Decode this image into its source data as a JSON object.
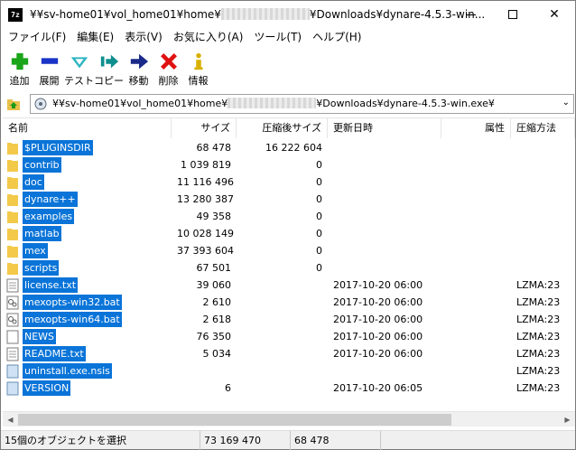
{
  "window": {
    "title_prefix": "¥¥sv-home01¥vol_home01¥home¥",
    "title_suffix": "¥Downloads¥dynare-4.5.3-win...",
    "app_icon_text": "7z"
  },
  "menu": [
    "ファイル(F)",
    "編集(E)",
    "表示(V)",
    "お気に入り(A)",
    "ツール(T)",
    "ヘルプ(H)"
  ],
  "toolbar": [
    {
      "label": "追加",
      "icon": "add-plus-icon",
      "color": "#1aa51a"
    },
    {
      "label": "展開",
      "icon": "extract-minus-icon",
      "color": "#1a34c8"
    },
    {
      "label": "テスト",
      "icon": "test-check-icon",
      "color": "#2bb3c0"
    },
    {
      "label": "コピー",
      "icon": "copy-arrow-icon",
      "color": "#0e8f8f"
    },
    {
      "label": "移動",
      "icon": "move-arrow-icon",
      "color": "#1a2a8a"
    },
    {
      "label": "削除",
      "icon": "delete-x-icon",
      "color": "#e01010"
    },
    {
      "label": "情報",
      "icon": "info-icon",
      "color": "#d8b000"
    }
  ],
  "address": {
    "prefix": "¥¥sv-home01¥vol_home01¥home¥",
    "suffix": "¥Downloads¥dynare-4.5.3-win.exe¥"
  },
  "columns": {
    "name": "名前",
    "size": "サイズ",
    "packed": "圧縮後サイズ",
    "modified": "更新日時",
    "attributes": "属性",
    "method": "圧縮方法"
  },
  "files": [
    {
      "name": "$PLUGINSDIR",
      "type": "folder",
      "size": "68 478",
      "packed": "16 222 604",
      "modified": "",
      "method": ""
    },
    {
      "name": "contrib",
      "type": "folder",
      "size": "1 039 819",
      "packed": "0",
      "modified": "",
      "method": ""
    },
    {
      "name": "doc",
      "type": "folder",
      "size": "11 116 496",
      "packed": "0",
      "modified": "",
      "method": ""
    },
    {
      "name": "dynare++",
      "type": "folder",
      "size": "13 280 387",
      "packed": "0",
      "modified": "",
      "method": ""
    },
    {
      "name": "examples",
      "type": "folder",
      "size": "49 358",
      "packed": "0",
      "modified": "",
      "method": ""
    },
    {
      "name": "matlab",
      "type": "folder",
      "size": "10 028 149",
      "packed": "0",
      "modified": "",
      "method": ""
    },
    {
      "name": "mex",
      "type": "folder",
      "size": "37 393 604",
      "packed": "0",
      "modified": "",
      "method": ""
    },
    {
      "name": "scripts",
      "type": "folder",
      "size": "67 501",
      "packed": "0",
      "modified": "",
      "method": ""
    },
    {
      "name": "license.txt",
      "type": "text",
      "size": "39 060",
      "packed": "",
      "modified": "2017-10-20 06:00",
      "method": "LZMA:23"
    },
    {
      "name": "mexopts-win32.bat",
      "type": "bat",
      "size": "2 610",
      "packed": "",
      "modified": "2017-10-20 06:00",
      "method": "LZMA:23"
    },
    {
      "name": "mexopts-win64.bat",
      "type": "bat",
      "size": "2 618",
      "packed": "",
      "modified": "2017-10-20 06:00",
      "method": "LZMA:23"
    },
    {
      "name": "NEWS",
      "type": "file",
      "size": "76 350",
      "packed": "",
      "modified": "2017-10-20 06:00",
      "method": "LZMA:23"
    },
    {
      "name": "README.txt",
      "type": "text",
      "size": "5 034",
      "packed": "",
      "modified": "2017-10-20 06:00",
      "method": "LZMA:23"
    },
    {
      "name": "uninstall.exe.nsis",
      "type": "nsis",
      "size": "",
      "packed": "",
      "modified": "",
      "method": "LZMA:23"
    },
    {
      "name": "VERSION",
      "type": "nsis",
      "size": "6",
      "packed": "",
      "modified": "2017-10-20 06:05",
      "method": "LZMA:23"
    }
  ],
  "status": {
    "selected": "15個のオブジェクトを選択",
    "total_size": "73 169 470",
    "packed_size": "68 478"
  },
  "scrollbar": {
    "thumb_fraction": 0.8
  },
  "colors": {
    "selection": "#0a74d8",
    "folder": "#f3c94a"
  }
}
